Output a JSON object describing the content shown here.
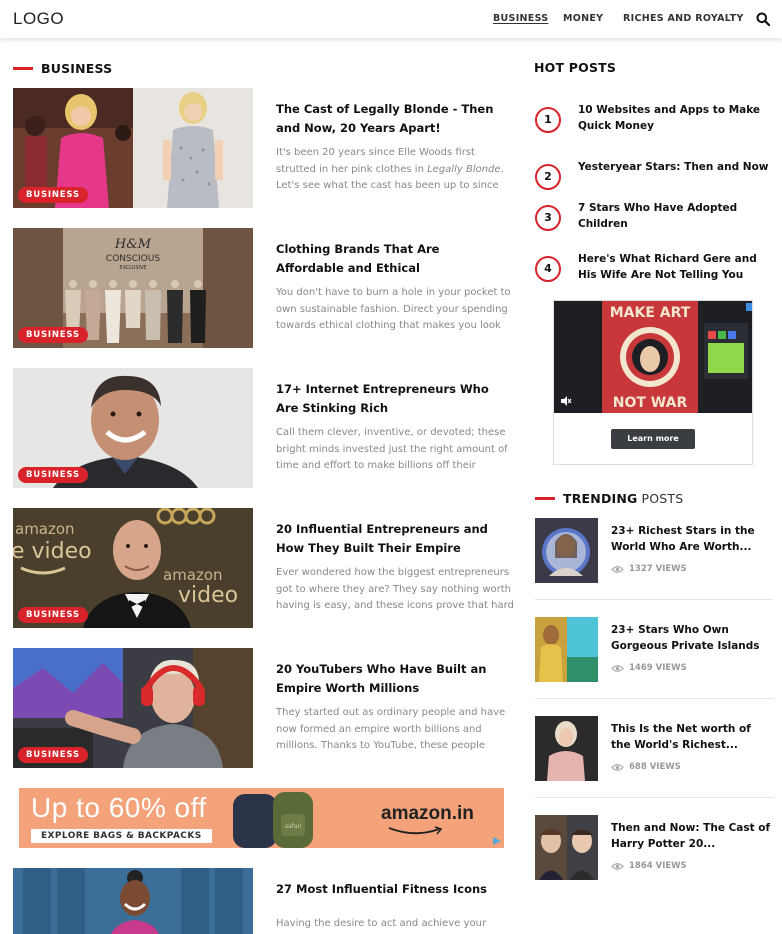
{
  "header": {
    "logo": "LOGO",
    "nav": [
      "BUSINESS",
      "MONEY",
      "RICHES AND ROYALTY"
    ]
  },
  "business": {
    "heading": "BUSINESS",
    "badge": "BUSINESS",
    "articles": [
      {
        "title": "The Cast of Legally Blonde - Then and Now, 20 Years Apart!",
        "excerpt_pre": "It's been 20 years since Elle Woods first strutted in her pink clothes in ",
        "excerpt_em": "Legally Blonde",
        "excerpt_post": ". Let's see what the cast has been up to since"
      },
      {
        "title": "Clothing Brands That Are Affordable and Ethical",
        "excerpt": "You don't have to burn a hole in your pocket to own sustainable fashion. Direct your spending towards ethical clothing that makes you look"
      },
      {
        "title": "17+ Internet Entrepreneurs Who Are Stinking Rich",
        "excerpt": "Call them clever, inventive, or devoted; these bright minds invested just the right amount of time and effort to make billions off their"
      },
      {
        "title": "20 Influential Entrepreneurs and How They Built Their Empire",
        "excerpt": "Ever wondered how the biggest entrepreneurs got to where they are? They say nothing worth having is easy, and these icons prove that hard"
      },
      {
        "title": "20 YouTubers Who Have Built an Empire Worth Millions",
        "excerpt": "They started out as ordinary people and have now formed an empire worth billions and millions. Thanks to YouTube, these people"
      },
      {
        "title": "27 Most Influential Fitness Icons",
        "excerpt": "Having the desire to act and achieve your goals"
      }
    ]
  },
  "thumb_text": {
    "hm_logo": "H&M",
    "hm_line1": "CONSCIOUS",
    "hm_line2": "EXCLUSIVE",
    "amazon1": "amazon",
    "amazon2": "e video",
    "amazon3": "amazon",
    "amazon4": "video"
  },
  "ad_banner": {
    "headline": "Up to 60% off",
    "subline": "EXPLORE BAGS & BACKPACKS",
    "brand": "amazon.in",
    "bag_label": "safari"
  },
  "hot_posts": {
    "heading": "HOT POSTS",
    "items": [
      {
        "num": "1",
        "title": "10 Websites and Apps to Make Quick Money"
      },
      {
        "num": "2",
        "title": "Yesteryear Stars: Then and Now"
      },
      {
        "num": "3",
        "title": "7 Stars Who Have Adopted Children"
      },
      {
        "num": "4",
        "title": "Here's What Richard Gere and His Wife Are Not Telling You"
      }
    ]
  },
  "side_ad": {
    "poster_top": "MAKE ART",
    "poster_bottom": "NOT WAR",
    "button": "Learn more"
  },
  "trending": {
    "heading_bold": "TRENDING",
    "heading_light": "POSTS",
    "items": [
      {
        "title": "23+ Richest Stars in the World Who Are Worth...",
        "views": "1327 VIEWS"
      },
      {
        "title": "23+ Stars Who Own Gorgeous Private Islands",
        "views": "1469 VIEWS"
      },
      {
        "title": "This Is the Net worth of the World's Richest...",
        "views": "688 VIEWS"
      },
      {
        "title": "Then and Now: The Cast of Harry Potter 20...",
        "views": "1864 VIEWS"
      }
    ]
  },
  "colors": {
    "accent": "#d8232a",
    "text": "#111111",
    "muted": "#888888"
  }
}
